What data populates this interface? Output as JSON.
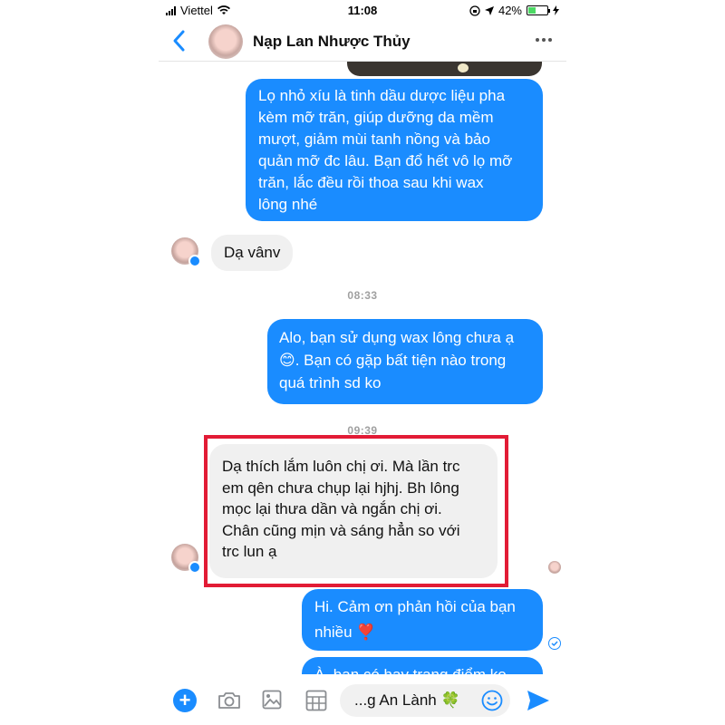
{
  "status_bar": {
    "carrier": "Viettel",
    "time": "11:08",
    "battery": "42%",
    "battery_level": 0.42
  },
  "header": {
    "contact_name": "Nạp Lan Nhược Thủy"
  },
  "messages": [
    {
      "direction": "outgoing",
      "lines": [
        "Lọ nhỏ xíu là tinh dầu dược liệu pha",
        "kèm mỡ trăn, giúp dưỡng da mềm",
        "mượt, giảm mùi tanh nồng và bảo",
        "quản mỡ đc lâu. Bạn đổ hết vô lọ mỡ",
        "trăn, lắc đều rồi thoa sau khi wax",
        "lông nhé"
      ]
    },
    {
      "direction": "incoming",
      "lines": [
        "Dạ vânv"
      ]
    },
    {
      "direction": "outgoing",
      "lines": [
        "Alo, bạn sử dụng wax lông chưa ạ",
        "😊. Bạn có gặp bất tiện nào trong",
        "quá trình sd ko"
      ]
    },
    {
      "direction": "incoming",
      "highlighted": true,
      "lines": [
        "Dạ thích lắm luôn chị ơi. Mà lần trc",
        "em qên chưa chụp lại hjhj. Bh lông",
        "mọc lại thưa dần và ngắn chị ơi.",
        "Chân cũng mịn và sáng hẳn so với",
        "trc lun ạ"
      ]
    },
    {
      "direction": "outgoing",
      "lines": [
        "Hi. Cảm ơn phản hồi của bạn",
        "nhiều ❣️"
      ]
    },
    {
      "direction": "outgoing",
      "lines": [
        "À, bạn có hay trang điểm ko"
      ]
    }
  ],
  "timestamps": [
    "08:33",
    "09:39"
  ],
  "composer": {
    "input_value": "...g An Lành 🍀"
  },
  "colors": {
    "outgoing_bubble": "#1a8cff",
    "incoming_bubble": "#f0f0f0",
    "highlight_border": "#e21b35",
    "accent": "#1a8cff"
  }
}
